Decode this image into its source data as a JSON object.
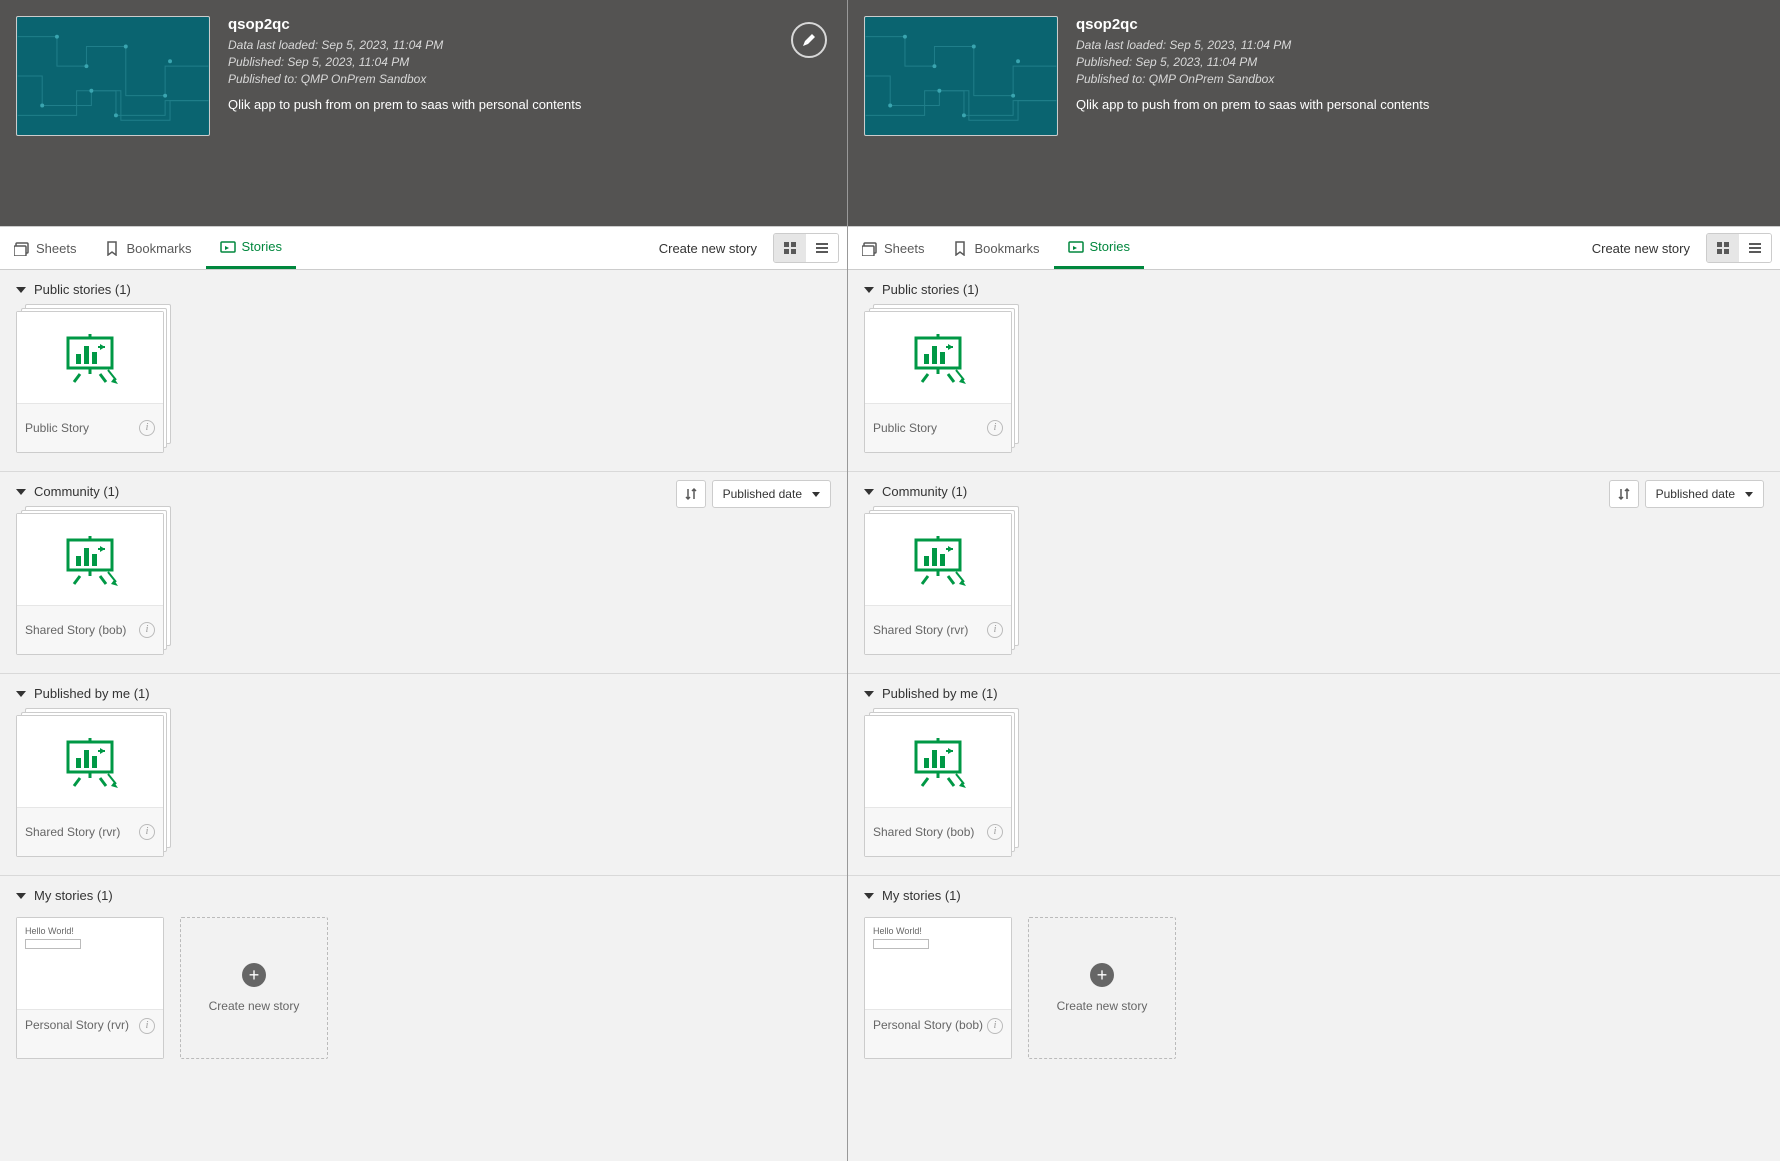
{
  "left": {
    "header": {
      "title": "qsop2qc",
      "meta1": "Data last loaded: Sep 5, 2023, 11:04 PM",
      "meta2": "Published: Sep 5, 2023, 11:04 PM",
      "meta3": "Published to: QMP OnPrem Sandbox",
      "desc": "Qlik app to push from on prem to saas with personal contents"
    },
    "tabs": {
      "sheets": "Sheets",
      "bookmarks": "Bookmarks",
      "stories": "Stories"
    },
    "create_link": "Create new story",
    "sections": {
      "public": {
        "title": "Public stories (1)",
        "card": "Public Story"
      },
      "community": {
        "title": "Community (1)",
        "card": "Shared Story (bob)",
        "sort_label": "Published date"
      },
      "published": {
        "title": "Published by me (1)",
        "card": "Shared Story (rvr)"
      },
      "mine": {
        "title": "My stories (1)",
        "card": "Personal Story (rvr)",
        "hello": "Hello World!",
        "create": "Create new story"
      }
    }
  },
  "right": {
    "header": {
      "title": "qsop2qc",
      "meta1": "Data last loaded: Sep 5, 2023, 11:04 PM",
      "meta2": "Published: Sep 5, 2023, 11:04 PM",
      "meta3": "Published to: QMP OnPrem Sandbox",
      "desc": "Qlik app to push from on prem to saas with personal contents"
    },
    "tabs": {
      "sheets": "Sheets",
      "bookmarks": "Bookmarks",
      "stories": "Stories"
    },
    "create_link": "Create new story",
    "sections": {
      "public": {
        "title": "Public stories (1)",
        "card": "Public Story"
      },
      "community": {
        "title": "Community (1)",
        "card": "Shared Story (rvr)",
        "sort_label": "Published date"
      },
      "published": {
        "title": "Published by me (1)",
        "card": "Shared Story (bob)"
      },
      "mine": {
        "title": "My stories (1)",
        "card": "Personal Story (bob)",
        "hello": "Hello World!",
        "create": "Create new story"
      }
    }
  }
}
